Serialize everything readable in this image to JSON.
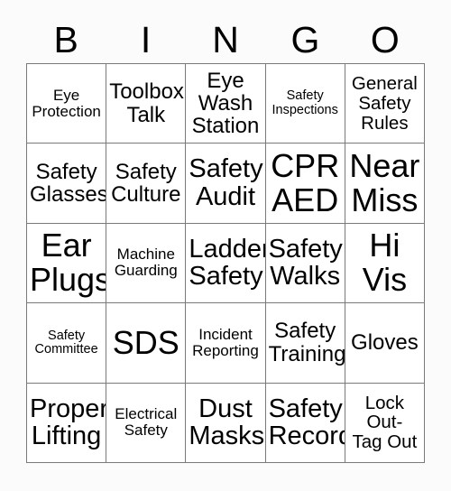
{
  "card": {
    "title_letters": [
      "B",
      "I",
      "N",
      "G",
      "O"
    ],
    "colors": {
      "background": "#fbfbfb",
      "cell_background": "#ffffff",
      "border": "#7a7a7a",
      "text": "#000000"
    },
    "grid": {
      "rows": 5,
      "columns": 5,
      "cells": [
        {
          "text": "Eye\nProtection",
          "size": "sm"
        },
        {
          "text": "Toolbox\nTalk",
          "size": "lg"
        },
        {
          "text": "Eye\nWash\nStation",
          "size": "lg"
        },
        {
          "text": "Safety\nInspections",
          "size": "xs"
        },
        {
          "text": "General\nSafety\nRules",
          "size": "md"
        },
        {
          "text": "Safety\nGlasses",
          "size": "lg"
        },
        {
          "text": "Safety\nCulture",
          "size": "lg"
        },
        {
          "text": "Safety\nAudit",
          "size": "xl"
        },
        {
          "text": "CPR\nAED",
          "size": "xxl"
        },
        {
          "text": "Near\nMiss",
          "size": "xxl"
        },
        {
          "text": "Ear\nPlugs",
          "size": "xxl"
        },
        {
          "text": "Machine\nGuarding",
          "size": "sm"
        },
        {
          "text": "Ladder\nSafety",
          "size": "xl"
        },
        {
          "text": "Safety\nWalks",
          "size": "xl"
        },
        {
          "text": "Hi\nVis",
          "size": "xxl"
        },
        {
          "text": "Safety\nCommittee",
          "size": "xs"
        },
        {
          "text": "SDS",
          "size": "xxl"
        },
        {
          "text": "Incident\nReporting",
          "size": "sm"
        },
        {
          "text": "Safety\nTraining",
          "size": "lg"
        },
        {
          "text": "Gloves",
          "size": "lg"
        },
        {
          "text": "Proper\nLifting",
          "size": "xl"
        },
        {
          "text": "Electrical\nSafety",
          "size": "sm"
        },
        {
          "text": "Dust\nMasks",
          "size": "xl"
        },
        {
          "text": "Safety\nRecord",
          "size": "xl"
        },
        {
          "text": "Lock\nOut-\nTag Out",
          "size": "md"
        }
      ]
    }
  }
}
